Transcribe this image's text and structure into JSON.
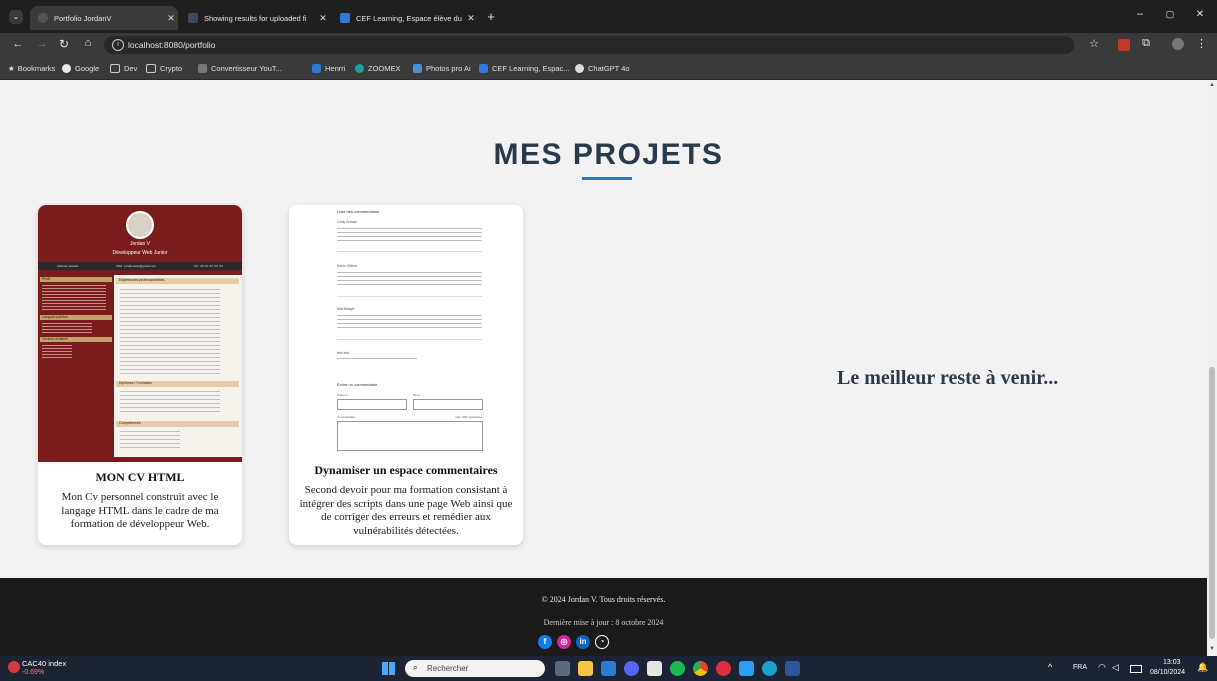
{
  "browser": {
    "tabs": [
      {
        "label": "Portfolio JordanV",
        "active": true
      },
      {
        "label": "Showing results for uploaded fi"
      },
      {
        "label": "CEF Learning, Espace élève du C"
      }
    ],
    "url": "localhost:8080/portfolio",
    "bookmarks": [
      "Bookmarks",
      "Google",
      "Dev",
      "Crypto",
      "Convertisseur YouT...",
      "Henrri",
      "ZOOMEX",
      "Photos pro Ai",
      "CEF Learning, Espac...",
      "ChatGPT 4o"
    ]
  },
  "page": {
    "section_title": "MES PROJETS",
    "projects": [
      {
        "title": "MON CV HTML",
        "description": "Mon Cv personnel construit avec le langage HTML dans le cadre de ma formation de développeur Web.",
        "thumb": {
          "name": "Jordan V",
          "role": "Développeur Web Junior",
          "contacts": [
            "Adresse postale",
            "Mail : jordanvalet@gmail.com",
            "Tel : 06 XX XX XX XX"
          ],
          "sections": [
            "Profil",
            "Langues parlées",
            "Centres d'intérêt",
            "Expériences professionnelles",
            "Diplômes / Formation",
            "Compétences"
          ]
        }
      },
      {
        "title": "Dynamiser un espace commentaires",
        "description": "Second devoir pour ma formation consistant à intégrer des scripts dans une page Web ainsi que de corriger des erreurs et remédier aux vulnérabilités détectées.",
        "thumb": {
          "heading": "Liste des commentaires",
          "authors": [
            "Cody Dobski",
            "Kevin Gilbert",
            "Mia Ndiaye",
            "test test"
          ],
          "form_title": "Écrire un commentaire",
          "labels": [
            "Prénom",
            "Nom",
            "Commentaire",
            "max. 400 caractères"
          ]
        }
      }
    ],
    "tagline": "Le meilleur reste à venir...",
    "footer": {
      "copyright": "© 2024 Jordan V. Tous droits réservés.",
      "last_update": "Dernière mise à jour : 8 octobre 2024"
    }
  },
  "taskbar": {
    "widget_name": "CAC40 index",
    "widget_change": "-0.69%",
    "search_placeholder": "Rechercher",
    "lang": "FRA",
    "time": "13:03",
    "date": "08/10/2024"
  },
  "colors": {
    "accent": "#2f79b8",
    "title": "#2b3a4a",
    "footer_bg": "#1a1a1a",
    "cv_maroon": "#7a1c1c"
  }
}
